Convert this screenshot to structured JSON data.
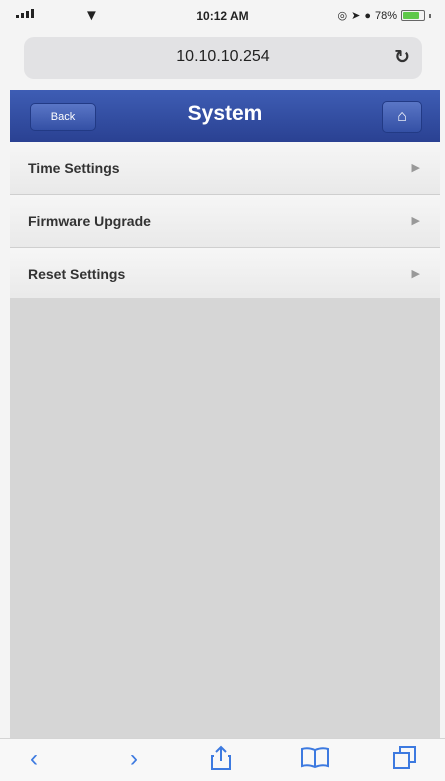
{
  "status_bar": {
    "time": "10:12 AM",
    "battery": "78%",
    "battery_level": 0.78
  },
  "browser": {
    "url": "10.10.10.254",
    "reload_icon": "reload-icon"
  },
  "header": {
    "back_label": "Back",
    "title": "System",
    "home_icon": "home-icon"
  },
  "menu": {
    "items": [
      {
        "label": "Time Settings"
      },
      {
        "label": "Firmware Upgrade"
      },
      {
        "label": "Reset Settings"
      }
    ]
  },
  "toolbar": {
    "icons": [
      "back-arrow-icon",
      "forward-arrow-icon",
      "share-icon",
      "bookmarks-icon",
      "tabs-icon"
    ]
  },
  "colors": {
    "header": "#2f4aa0",
    "link": "#3d7ae0",
    "battery": "#5fc84a"
  }
}
